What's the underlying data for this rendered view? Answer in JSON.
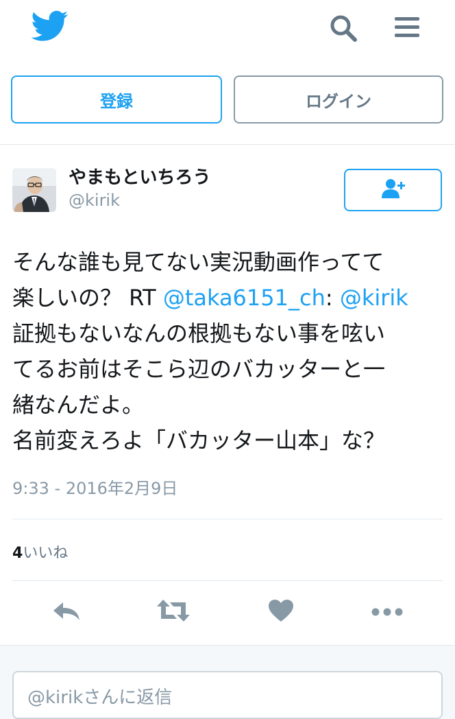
{
  "header": {
    "logo_icon": "twitter-bird-icon",
    "search_icon": "search-icon",
    "menu_icon": "hamburger-menu-icon",
    "register_label": "登録",
    "login_label": "ログイン"
  },
  "tweet": {
    "author_name": "やまもといちろう",
    "author_handle": "@kirik",
    "follow_icon": "follow-user-icon",
    "text": {
      "line1": "そんな誰も見てない実況動画作ってて",
      "line2_pre": "楽しいの？ RT ",
      "mention1": "@taka6151_ch",
      "line2_mid": ": ",
      "mention2": "@kirik",
      "line3": "証拠もないなんの根拠もない事を呟い",
      "line4": "てるお前はそこら辺のバカッターと一",
      "line5": "緒なんだよ。",
      "line6": "名前変えろよ「バカッター山本」な？"
    },
    "timestamp": "9:33 - 2016年2月9日",
    "likes_count": "4",
    "likes_label": "いいね"
  },
  "actions": {
    "reply_icon": "reply-icon",
    "retweet_icon": "retweet-icon",
    "like_icon": "heart-icon",
    "more_icon": "more-dots-icon"
  },
  "reply": {
    "placeholder": "@kirikさんに返信"
  },
  "colors": {
    "brand": "#1da1f2",
    "muted": "#8899a6",
    "text": "#14171a",
    "action_icon": "#8899a6"
  }
}
